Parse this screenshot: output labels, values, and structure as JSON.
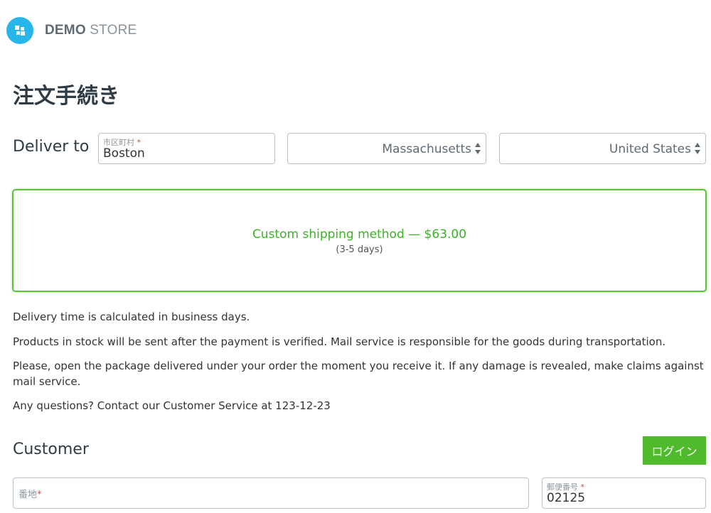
{
  "header": {
    "brand_bold": "DEMO",
    "brand_light": "STORE",
    "logo_icon": "windows-grid-icon",
    "accent_color": "#26b6ea"
  },
  "page_title": "注文手続き",
  "deliver": {
    "label": "Deliver to",
    "city": {
      "label": "市区町村",
      "required_mark": "*",
      "value": "Boston"
    },
    "state": {
      "selected": "Massachusetts"
    },
    "country": {
      "selected": "United States"
    }
  },
  "shipping": {
    "method": "Custom shipping method — $63.00",
    "days": "(3-5 days)",
    "selected_color": "#5bc236"
  },
  "info": [
    "Delivery time is calculated in business days.",
    "Products in stock will be sent after the payment is verified. Mail service is responsible for the goods during transportation.",
    "Please, open the package delivered under your order the moment you receive it. If any damage is revealed, make claims against mail service.",
    "Any questions? Contact our Customer Service at 123-12-23"
  ],
  "customer": {
    "title": "Customer",
    "login_label": "ログイン",
    "address": {
      "label": "番地",
      "required_mark": "*",
      "value": ""
    },
    "postal": {
      "label": "郵便番号",
      "required_mark": "*",
      "value": "02125"
    }
  }
}
